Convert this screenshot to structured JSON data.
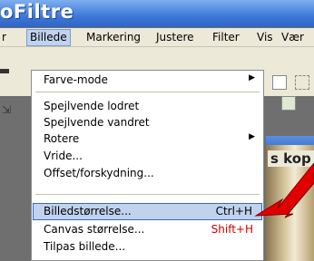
{
  "window": {
    "title": "oFiltre"
  },
  "menubar": {
    "items": [
      {
        "label": "r"
      },
      {
        "label": "Billede"
      },
      {
        "label": "Markering"
      },
      {
        "label": "Justere"
      },
      {
        "label": "Filter"
      },
      {
        "label": "Vis"
      },
      {
        "label": "Vær"
      }
    ]
  },
  "background": {
    "partial_text": "s kop"
  },
  "dropdown": {
    "items": [
      {
        "label": "Farve-mode",
        "submenu": true
      },
      {
        "label": "Spejlvende lodret"
      },
      {
        "label": "Spejlvende vandret"
      },
      {
        "label": "Rotere",
        "submenu": true
      },
      {
        "label": "Vride..."
      },
      {
        "label": "Offset/forskydning..."
      },
      {
        "label": "Billedstørrelse...",
        "shortcut": "Ctrl+H",
        "highlighted": true
      },
      {
        "label": "Canvas størrelse...",
        "shortcut": "Shift+H",
        "shortcut_color": "#d00000"
      },
      {
        "label": "Tilpas billede..."
      }
    ]
  },
  "colors": {
    "title_bar": "#3d78d8",
    "menu_highlight": "#c1d2ee",
    "annotation_arrow": "#e00000"
  }
}
